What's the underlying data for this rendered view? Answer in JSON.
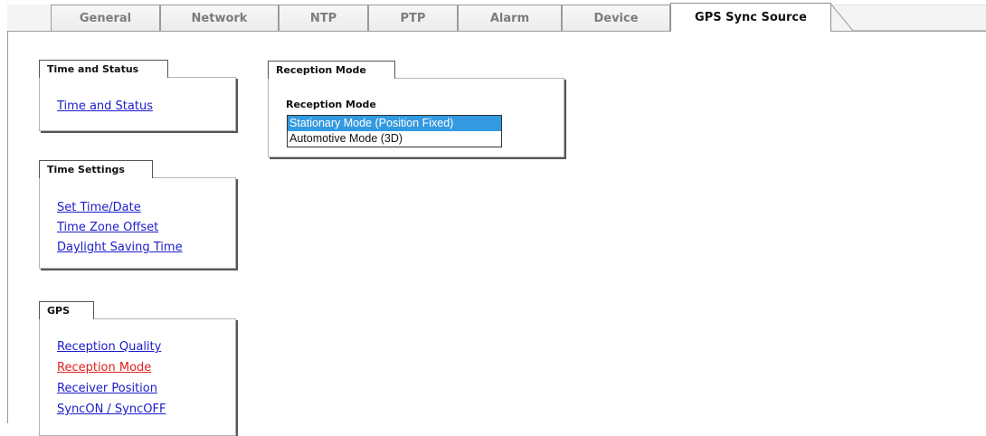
{
  "tabs": [
    {
      "label": "General"
    },
    {
      "label": "Network"
    },
    {
      "label": "NTP"
    },
    {
      "label": "PTP"
    },
    {
      "label": "Alarm"
    },
    {
      "label": "Device"
    },
    {
      "label": "GPS Sync Source"
    }
  ],
  "active_tab": "GPS Sync Source",
  "sidebar": {
    "time_status": {
      "title": "Time and Status",
      "links": [
        {
          "label": "Time and Status"
        }
      ]
    },
    "time_settings": {
      "title": "Time Settings",
      "links": [
        {
          "label": "Set Time/Date"
        },
        {
          "label": "Time Zone Offset"
        },
        {
          "label": "Daylight Saving Time"
        }
      ]
    },
    "gps": {
      "title": "GPS",
      "links": [
        {
          "label": "Reception Quality"
        },
        {
          "label": "Reception Mode"
        },
        {
          "label": "Receiver Position"
        },
        {
          "label": "SyncON / SyncOFF"
        }
      ],
      "current": "Reception Mode"
    }
  },
  "reception_mode_panel": {
    "title": "Reception Mode",
    "field_label": "Reception Mode",
    "options": [
      {
        "label": "Stationary Mode (Position Fixed)",
        "selected": true
      },
      {
        "label": "Automotive Mode (3D)",
        "selected": false
      }
    ]
  },
  "colors": {
    "link": "#1c1ccc",
    "current_link": "#e02020",
    "selected_option_bg": "#3399e0"
  }
}
